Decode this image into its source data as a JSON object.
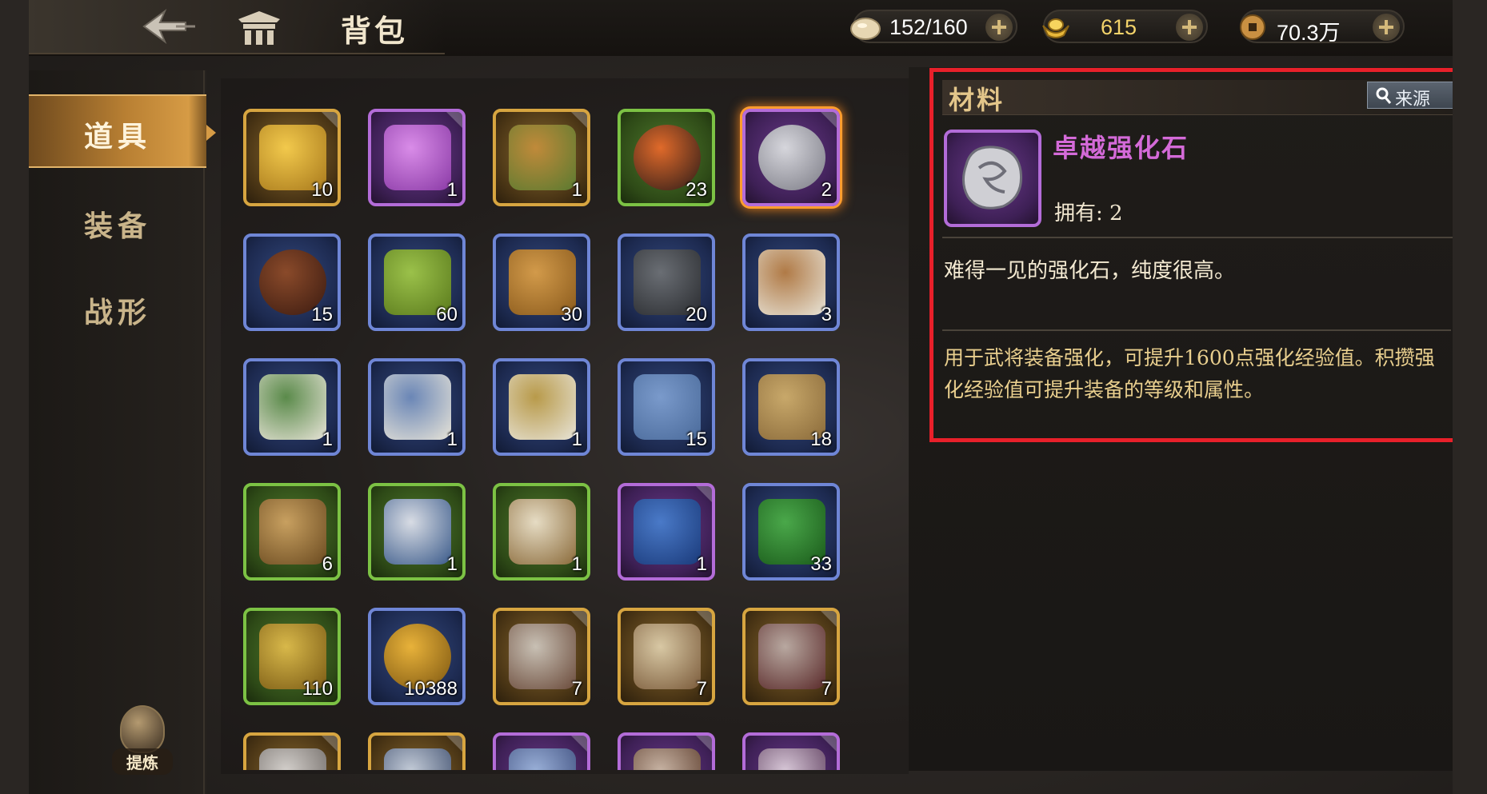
{
  "header": {
    "title": "背包",
    "resources": [
      {
        "name": "stamina",
        "value": "152/160",
        "color": "#ffffff"
      },
      {
        "name": "gold-ingot",
        "value": "615",
        "color": "#f3d36a"
      },
      {
        "name": "copper-coin",
        "value": "70.3万",
        "color": "#ffffff"
      }
    ]
  },
  "sidebar": {
    "items": [
      {
        "label": "道具",
        "active": true
      },
      {
        "label": "装备",
        "active": false
      },
      {
        "label": "战形",
        "active": false
      }
    ],
    "refine_label": "提炼"
  },
  "inventory": {
    "items": [
      {
        "icon": "gold-crystal-cluster-icon",
        "quality": "gold",
        "count": "10"
      },
      {
        "icon": "purple-crystal-cluster-icon",
        "quality": "purple",
        "count": "1"
      },
      {
        "icon": "bronze-qilin-icon",
        "quality": "gold",
        "count": "1"
      },
      {
        "icon": "fire-orb-icon",
        "quality": "green",
        "count": "23"
      },
      {
        "icon": "silver-stone-icon",
        "quality": "purple",
        "count": "2",
        "selected": true
      },
      {
        "icon": "bronze-ore-icon",
        "quality": "blue",
        "count": "15"
      },
      {
        "icon": "bamboo-log-icon",
        "quality": "blue",
        "count": "60"
      },
      {
        "icon": "animal-hide-icon",
        "quality": "blue",
        "count": "30"
      },
      {
        "icon": "iron-ingot-icon",
        "quality": "blue",
        "count": "20"
      },
      {
        "icon": "brown-book-icon",
        "quality": "blue",
        "count": "3"
      },
      {
        "icon": "green-book-icon",
        "quality": "blue",
        "count": "1"
      },
      {
        "icon": "blue-book-icon",
        "quality": "blue",
        "count": "1"
      },
      {
        "icon": "gold-book-icon",
        "quality": "blue",
        "count": "1"
      },
      {
        "icon": "blue-manual-icon",
        "quality": "blue",
        "count": "15"
      },
      {
        "icon": "tan-manual-icon",
        "quality": "blue",
        "count": "18"
      },
      {
        "icon": "bamboo-scroll-icon",
        "quality": "green",
        "count": "6"
      },
      {
        "icon": "blue-open-book-icon",
        "quality": "green",
        "count": "1"
      },
      {
        "icon": "tan-open-book-icon",
        "quality": "green",
        "count": "1"
      },
      {
        "icon": "blue-tome-icon",
        "quality": "purple",
        "count": "1"
      },
      {
        "icon": "green-tome-icon",
        "quality": "blue",
        "count": "33"
      },
      {
        "icon": "gold-tome-icon",
        "quality": "green",
        "count": "110"
      },
      {
        "icon": "gold-coin-icon",
        "quality": "blue",
        "count": "10388"
      },
      {
        "icon": "warrior-portrait-card-icon",
        "quality": "gold",
        "count": "7"
      },
      {
        "icon": "general-portrait-card-icon",
        "quality": "gold",
        "count": "7"
      },
      {
        "icon": "swordsman-portrait-card-icon",
        "quality": "gold",
        "count": "7"
      },
      {
        "icon": "elder-portrait-card-icon",
        "quality": "gold",
        "count": ""
      },
      {
        "icon": "scholar-portrait-card-icon",
        "quality": "gold",
        "count": ""
      },
      {
        "icon": "blue-warrior-portrait-card-icon",
        "quality": "purple",
        "count": ""
      },
      {
        "icon": "strategist-portrait-card-icon",
        "quality": "purple",
        "count": ""
      },
      {
        "icon": "lady-portrait-card-icon",
        "quality": "purple",
        "count": ""
      }
    ]
  },
  "detail": {
    "category": "材料",
    "source_label": "来源",
    "item_name": "卓越强化石",
    "owned_label": "拥有:",
    "owned_count": "2",
    "flavor_text": "难得一见的强化石，纯度很高。",
    "usage_text": "用于武将装备强化，可提升1600点强化经验值。积攒强化经验值可提升装备的等级和属性。",
    "name_color": "#d46ad8"
  }
}
